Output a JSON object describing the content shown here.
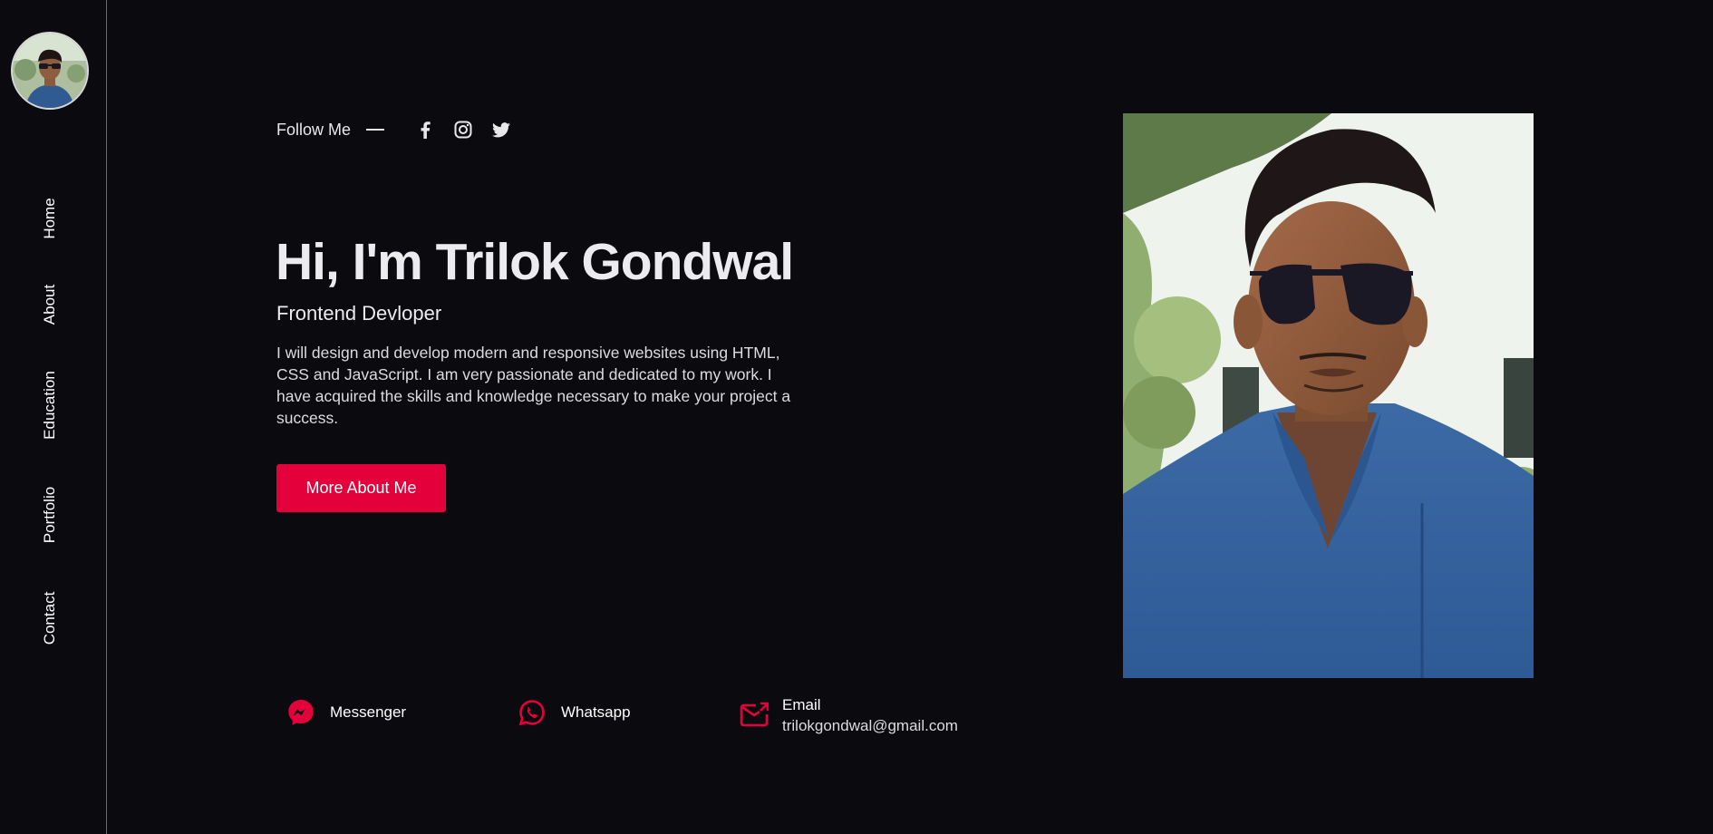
{
  "sidebar": {
    "nav": [
      {
        "label": "Home"
      },
      {
        "label": "About"
      },
      {
        "label": "Education"
      },
      {
        "label": "Portfolio"
      },
      {
        "label": "Contact"
      }
    ]
  },
  "follow": {
    "label": "Follow Me",
    "icons": [
      "facebook-icon",
      "instagram-icon",
      "twitter-icon"
    ]
  },
  "hero": {
    "title": "Hi, I'm Trilok Gondwal",
    "subtitle": "Frontend Devloper",
    "description": "I will design and develop modern and responsive websites using HTML, CSS and JavaScript. I am very passionate and dedicated to my work. I have acquired the skills and knowledge necessary to make your project a success.",
    "button_label": "More About Me"
  },
  "contacts": {
    "messenger": {
      "label": "Messenger",
      "icon": "messenger-icon"
    },
    "whatsapp": {
      "label": "Whatsapp",
      "icon": "whatsapp-icon"
    },
    "email": {
      "label": "Email",
      "value": "trilokgondwal@gmail.com",
      "icon": "email-icon"
    }
  },
  "colors": {
    "background": "#0b0a0f",
    "accent": "#e4003b",
    "text": "#ffffff"
  }
}
